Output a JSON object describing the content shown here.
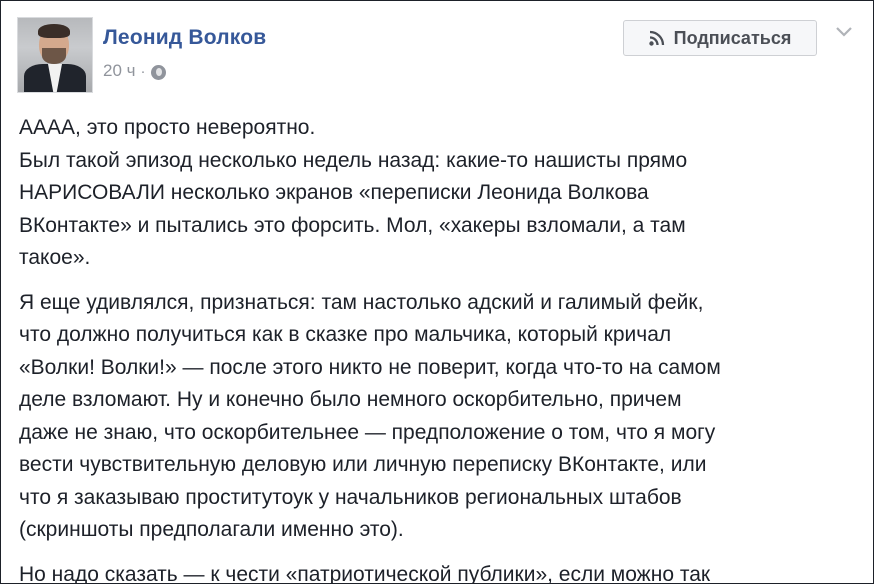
{
  "post": {
    "author": "Леонид Волков",
    "time": "20 ч",
    "time_separator": "·",
    "privacy_icon": "globe-icon",
    "follow_button_label": "Подписаться",
    "follow_icon": "rss-icon",
    "menu_icon": "chevron-down-icon",
    "paragraphs": [
      {
        "lines": [
          "АААА, это просто невероятно.",
          "Был такой эпизод несколько недель назад: какие-то нашисты прямо",
          "НАРИСОВАЛИ несколько экранов «переписки Леонида Волкова",
          "ВКонтакте» и пытались это форсить. Мол, «хакеры взломали, а там",
          "такое»."
        ]
      },
      {
        "lines": [
          "Я еще удивлялся, признаться: там настолько адский и галимый фейк,",
          "что должно получиться как в сказке про мальчика, который кричал",
          "«Волки! Волки!» — после этого никто не поверит, когда что-то на самом",
          "деле взломают. Ну и конечно было немного оскорбительно, причем",
          "даже не знаю, что оскорбительнее — предположение о том, что я могу",
          "вести чувствительную деловую или личную переписку ВКонтакте, или",
          "что я заказываю проститутоук у начальников региональных штабов",
          "(скриншоты предполагали именно это)."
        ]
      },
      {
        "lines": [
          "Но надо сказать — к чести «патриотической публики», если можно так"
        ]
      }
    ]
  },
  "colors": {
    "author_link": "#365899",
    "meta_text": "#90949c",
    "body_text": "#1d2129",
    "button_bg": "#f6f7f9",
    "button_border": "#ced0d4"
  }
}
